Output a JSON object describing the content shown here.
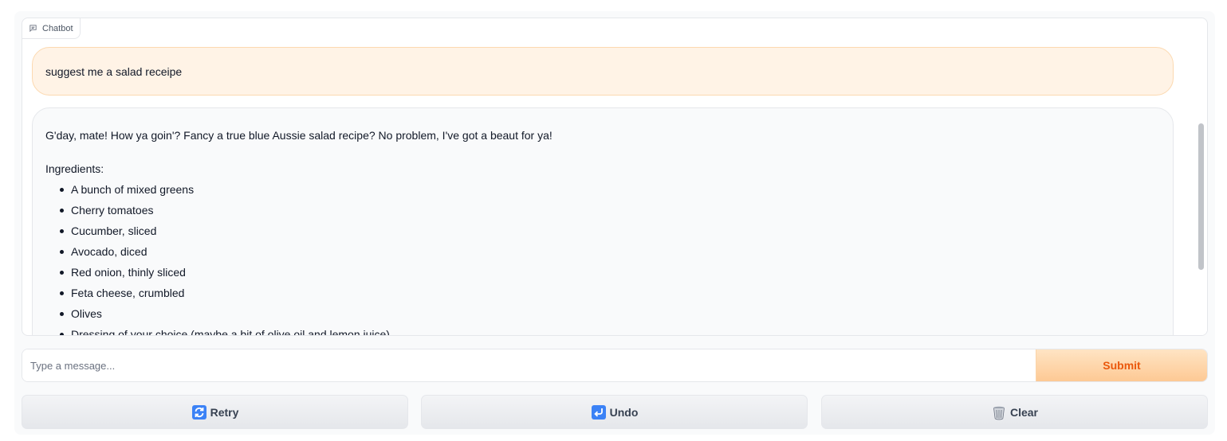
{
  "chatbot": {
    "label": "Chatbot",
    "icon": "chat-bubble-icon",
    "messages": {
      "user": "suggest me a salad receipe",
      "bot_intro": "G'day, mate! How ya goin'? Fancy a true blue Aussie salad recipe? No problem, I've got a beaut for ya!",
      "bot_ingredients_heading": "Ingredients:",
      "bot_ingredients": [
        "A bunch of mixed greens",
        "Cherry tomatoes",
        "Cucumber, sliced",
        "Avocado, diced",
        "Red onion, thinly sliced",
        "Feta cheese, crumbled",
        "Olives",
        "Dressing of your choice (maybe a bit of olive oil and lemon juice)"
      ]
    }
  },
  "composer": {
    "placeholder": "Type a message...",
    "value": "",
    "submit_label": "Submit"
  },
  "controls": {
    "retry_label": "Retry",
    "retry_icon": "retry-arrows-icon",
    "undo_label": "Undo",
    "undo_icon": "undo-arrow-icon",
    "clear_label": "Clear",
    "clear_icon": "wastebasket-icon"
  },
  "colors": {
    "accent": "#ea580c",
    "user_bubble": "#fff3e6",
    "bot_bubble": "#f9fafb"
  }
}
